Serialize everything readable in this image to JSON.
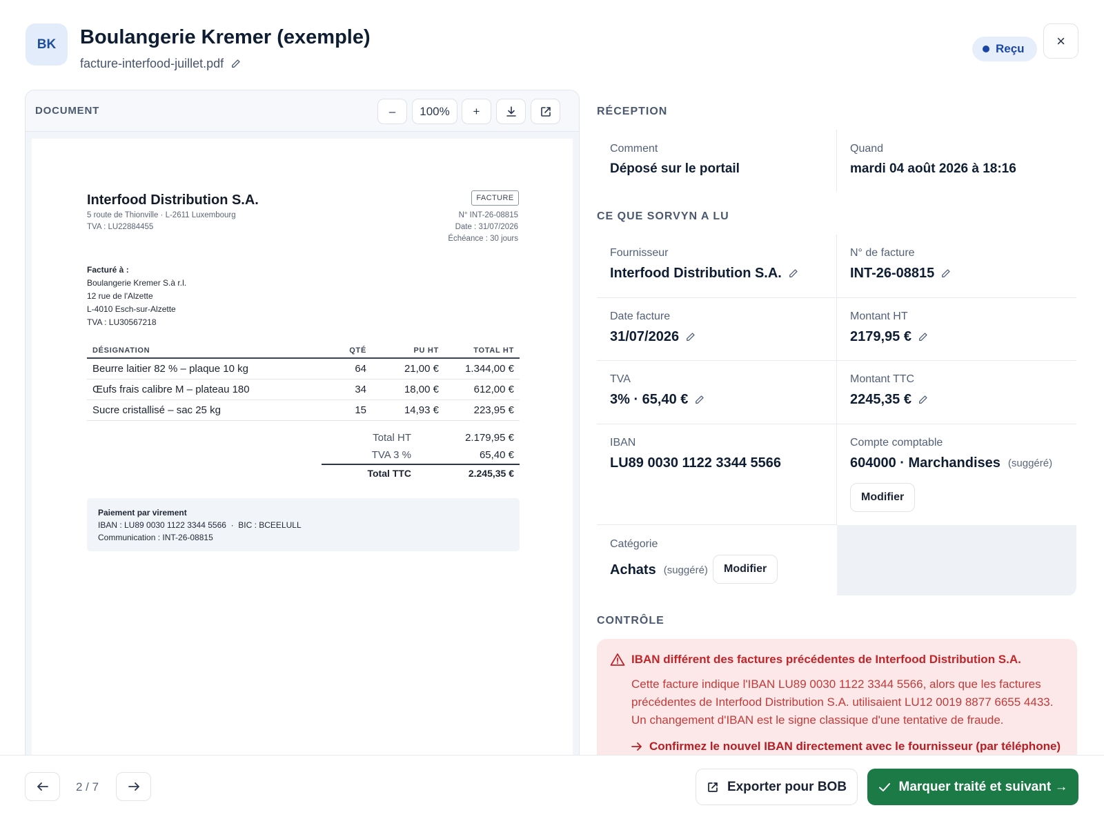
{
  "header": {
    "avatar": "BK",
    "title": "Boulangerie Kremer (exemple)",
    "filename": "facture-interfood-juillet.pdf",
    "status": "Reçu",
    "close_label": "×"
  },
  "document": {
    "label": "DOCUMENT",
    "zoom_out": "–",
    "zoom": "100%",
    "zoom_in": "+",
    "invoice": {
      "company": "Interfood Distribution S.A.",
      "address": "5 route de Thionville · L-2611 Luxembourg",
      "vat": "TVA : LU22884455",
      "doc_type": "FACTURE",
      "number": "N° INT-26-08815",
      "date": "Date : 31/07/2026",
      "due": "Échéance : 30 jours",
      "billto_title": "Facturé à :",
      "billto_lines": [
        "Boulangerie Kremer S.à r.l.",
        "12 rue de l'Alzette",
        "L-4010 Esch-sur-Alzette",
        "TVA : LU30567218"
      ],
      "columns": [
        "DÉSIGNATION",
        "QTÉ",
        "PU HT",
        "TOTAL HT"
      ],
      "rows": [
        [
          "Beurre laitier 82 % – plaque 10 kg",
          "64",
          "21,00 €",
          "1.344,00 €"
        ],
        [
          "Œufs frais calibre M – plateau 180",
          "34",
          "18,00 €",
          "612,00 €"
        ],
        [
          "Sucre cristallisé – sac 25 kg",
          "15",
          "14,93 €",
          "223,95 €"
        ]
      ],
      "totals": [
        {
          "label": "Total HT",
          "value": "2.179,95 €"
        },
        {
          "label": "TVA 3 %",
          "value": "65,40 €"
        },
        {
          "label": "Total TTC",
          "value": "2.245,35 €"
        }
      ],
      "payment_title": "Paiement par virement",
      "payment_iban": "IBAN : LU89 0030 1122 3344 5566  ·  BIC : BCEELULL",
      "payment_comm": "Communication : INT-26-08815"
    }
  },
  "reception": {
    "title": "RÉCEPTION",
    "how_label": "Comment",
    "how_value": "Déposé sur le portail",
    "when_label": "Quand",
    "when_value": "mardi 04 août 2026 à 18:16"
  },
  "extracted": {
    "title": "CE QUE SORVYN A LU",
    "supplier_label": "Fournisseur",
    "supplier_value": "Interfood Distribution S.A.",
    "invoice_no_label": "N° de facture",
    "invoice_no_value": "INT-26-08815",
    "date_label": "Date facture",
    "date_value": "31/07/2026",
    "ht_label": "Montant HT",
    "ht_value": "2179,95 €",
    "vat_label": "TVA",
    "vat_value": "3% · 65,40 €",
    "ttc_label": "Montant TTC",
    "ttc_value": "2245,35 €",
    "iban_label": "IBAN",
    "iban_value": "LU89 0030 1122 3344 5566",
    "account_label": "Compte comptable",
    "account_value": "604000 · Marchandises",
    "account_suggest": "(suggéré)",
    "account_button": "Modifier",
    "category_label": "Catégorie",
    "category_value": "Achats",
    "category_suggest": "(suggéré)",
    "category_button": "Modifier"
  },
  "control": {
    "title": "CONTRÔLE",
    "alert_title": "IBAN différent des factures précédentes de Interfood Distribution S.A.",
    "alert_body": "Cette facture indique l'IBAN LU89 0030 1122 3344 5566, alors que les factures précédentes de Interfood Distribution S.A. utilisaient LU12 0019 8877 6655 4433. Un changement d'IBAN est le signe classique d'une tentative de fraude.",
    "alert_action": "Confirmez le nouvel IBAN directement avec le fournisseur (par téléphone)",
    "colors": {
      "danger": "#c0252a",
      "danger_bg": "#fce8e8"
    }
  },
  "footer": {
    "pager": "2 / 7",
    "export_label": "Exporter pour BOB",
    "primary_label": "Marquer traité et suivant →",
    "colors": {
      "primary": "#1b7a46"
    }
  }
}
